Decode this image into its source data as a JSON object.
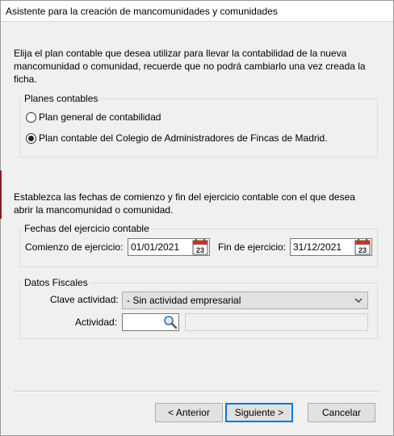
{
  "window": {
    "title": "Asistente para la creación de mancomunidades y comunidades"
  },
  "section1": {
    "instruction_line1": "Elija el plan contable que desea utilizar para llevar la contabilidad de la nueva",
    "instruction_line2": "mancomunidad o comunidad, recuerde que no podrá cambiarlo una vez creada la",
    "instruction_line3": "ficha.",
    "group_label": "Planes contables",
    "options": [
      {
        "label": "Plan general de contabilidad",
        "selected": false
      },
      {
        "label": "Plan contable del Colegio de Administradores de Fincas de Madrid.",
        "selected": true
      }
    ]
  },
  "section2": {
    "instruction_line1": "Establezca las fechas de comienzo y fin del ejercicio contable con el que desea",
    "instruction_line2": "abrir la mancomunidad o comunidad.",
    "group_label": "Fechas del ejercicio contable",
    "start_label": "Comienzo de ejercicio:",
    "start_value": "01/01/2021",
    "end_label": "Fin de ejercicio:",
    "end_value": "31/12/2021",
    "calendar_day": "23"
  },
  "section3": {
    "group_label": "Datos Fiscales",
    "clave_label": "Clave actividad:",
    "clave_value": "- Sin actividad empresarial",
    "actividad_label": "Actividad:",
    "actividad_value": "",
    "actividad_description": ""
  },
  "buttons": {
    "back": "< Anterior",
    "next": "Siguiente >",
    "cancel": "Cancelar"
  },
  "colors": {
    "accent": "#0078d7",
    "calendar_red": "#c0392b"
  },
  "icons": [
    "calendar-icon",
    "search-icon",
    "chevron-down-icon"
  ]
}
